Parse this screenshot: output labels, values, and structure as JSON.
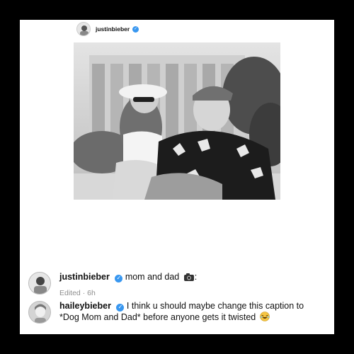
{
  "header": {
    "username": "justinbieber"
  },
  "comments": [
    {
      "username": "justinbieber",
      "text": "mom and dad",
      "after_emoji": ":",
      "emoji_icon": "camera-emoji",
      "meta": "Edited · 6h"
    },
    {
      "username": "haileybieber",
      "text": "I think u should maybe change this caption to *Dog Mom and Dad* before anyone gets it twisted",
      "emoji_icon": "laughing-emoji"
    }
  ],
  "colors": {
    "verified_blue": "#3897f0",
    "meta_gray": "#8e8e8e"
  }
}
